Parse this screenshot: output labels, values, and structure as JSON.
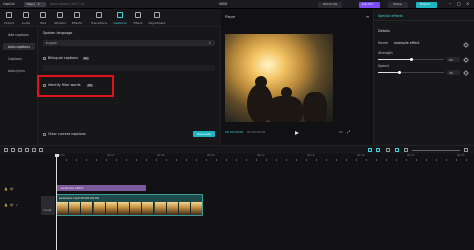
{
  "titlebar": {
    "app_name": "CapCut",
    "menu_label": "Menu",
    "project_name": "Auto caption 0607-01",
    "timecode": "0608",
    "shortcuts_label": "Shortcuts",
    "join_pro_label": "Join Pro",
    "share_label": "Share",
    "export_label": "Export"
  },
  "toolbar": {
    "items": [
      {
        "label": "Import",
        "icon": "import-icon",
        "active": false
      },
      {
        "label": "Audio",
        "icon": "audio-icon",
        "active": false
      },
      {
        "label": "Text",
        "icon": "text-icon",
        "active": false
      },
      {
        "label": "Stickers",
        "icon": "sticker-icon",
        "active": false
      },
      {
        "label": "Effects",
        "icon": "effects-icon",
        "active": false
      },
      {
        "label": "Transitions",
        "icon": "transitions-icon",
        "active": false
      },
      {
        "label": "Captions",
        "icon": "captions-icon",
        "active": true
      },
      {
        "label": "Filters",
        "icon": "filters-icon",
        "active": false
      },
      {
        "label": "Adjustment",
        "icon": "adjustment-icon",
        "active": false
      }
    ]
  },
  "leftnav": {
    "items": [
      {
        "label": "Add captions",
        "selected": false
      },
      {
        "label": "Auto captions",
        "selected": true
      },
      {
        "label": "Captions",
        "selected": false
      },
      {
        "label": "Auto lyrics",
        "selected": false
      }
    ]
  },
  "captions_panel": {
    "spoken_language_label": "Spoken language",
    "language_value": "English",
    "bilingual_label": "Bilingual captions",
    "bilingual_badge": "Pro",
    "filler_label": "Identify filler words",
    "filler_badge": "Pro",
    "clear_label": "Clear current captions",
    "generate_label": "Generate"
  },
  "player": {
    "title": "Player",
    "current_time": "00:00:00:00",
    "total_time": "00:00:09:00"
  },
  "right_panel": {
    "title": "Special effects",
    "details_label": "Details",
    "name_label": "Name",
    "name_value": "example effect",
    "strength_label": "Strength",
    "strength_value": "50",
    "strength_level": 0.5,
    "speed_label": "Speed",
    "speed_value": "33",
    "speed_level": 0.33
  },
  "timeline": {
    "ruler_labels": [
      "00:00",
      "00:03",
      "00:06",
      "00:09",
      "00:12",
      "00:15",
      "00:18",
      "00:21",
      "00:24"
    ],
    "effect_clip_label": "example effect",
    "video_clip_label": "example.mp4  00:00:09:00",
    "cover_label": "Cover"
  },
  "colors": {
    "accent": "#1fb4bf",
    "highlight_box": "#e0121b",
    "effect_clip": "#7d5a9e",
    "video_clip": "#1e4a49",
    "join_pro": "#7b4cf5"
  }
}
